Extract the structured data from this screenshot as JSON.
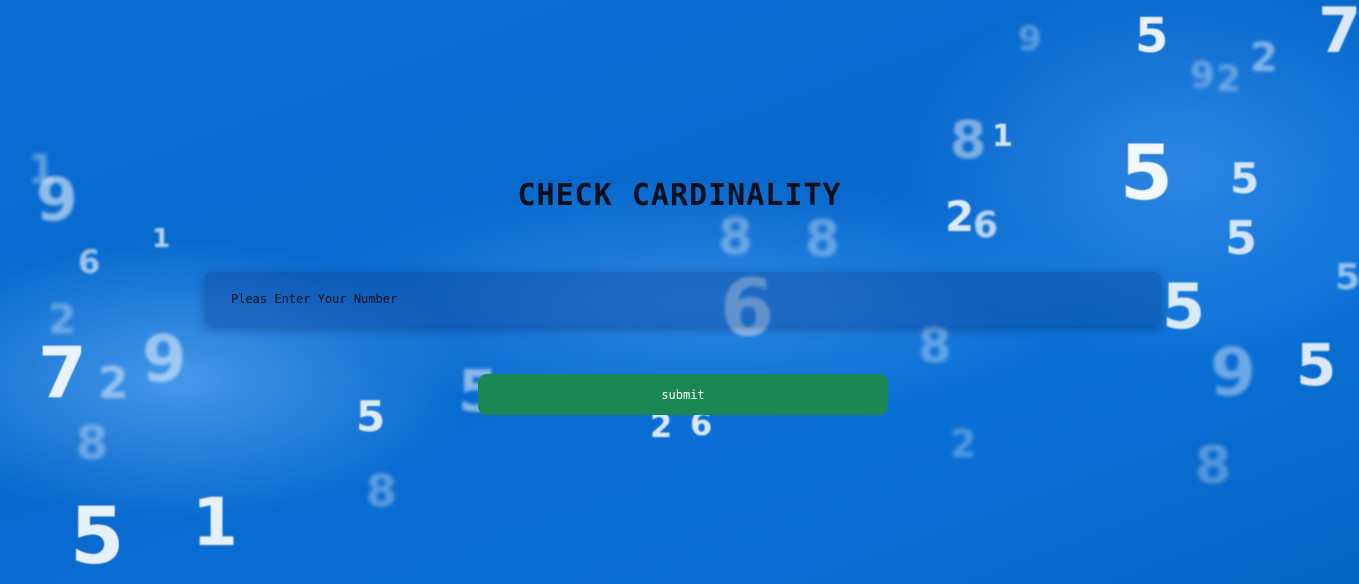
{
  "page": {
    "title": "CHECK CARDINALITY"
  },
  "form": {
    "number_input": {
      "placeholder": "Pleas Enter Your Number",
      "value": ""
    },
    "submit_label": "submit"
  },
  "background": {
    "digits": [
      "9",
      "5",
      "7",
      "2",
      "9",
      "2",
      "8",
      "1",
      "5",
      "5",
      "2",
      "6",
      "5",
      "5",
      "6",
      "5",
      "9",
      "5",
      "8",
      "7",
      "2",
      "9",
      "1",
      "6",
      "8",
      "5",
      "2",
      "1",
      "5",
      "1",
      "5",
      "8",
      "9",
      "2",
      "8",
      "6",
      "8",
      "8",
      "2"
    ]
  },
  "colors": {
    "background": "#0a6ed3",
    "title": "#0b0f1e",
    "submit_button": "#1b8753",
    "submit_text": "#ffffff"
  }
}
